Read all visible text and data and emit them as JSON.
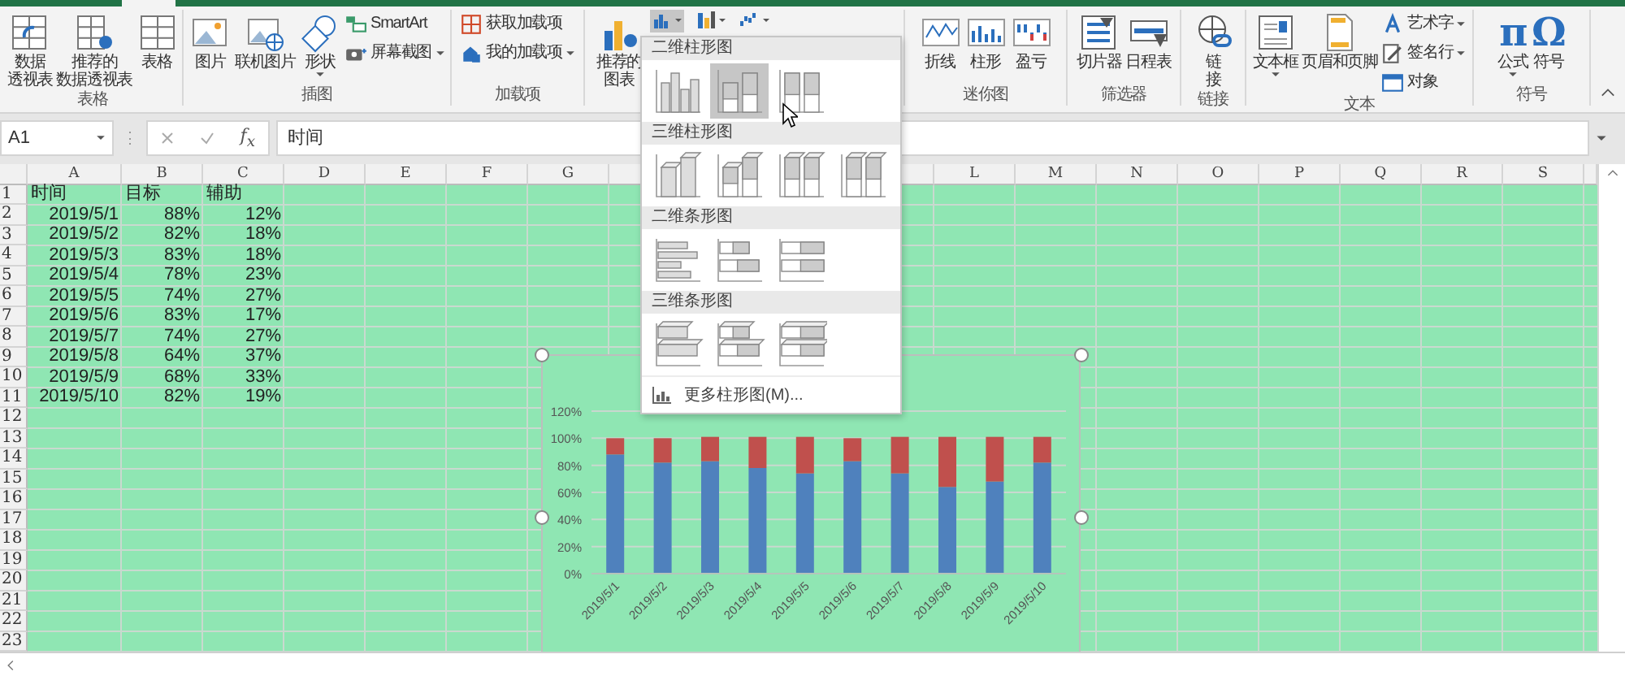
{
  "ribbon": {
    "groups": [
      {
        "label": "表格",
        "items": [
          {
            "kind": "large",
            "lines": [
              "数据",
              "透视表"
            ],
            "dropdown": false
          },
          {
            "kind": "large",
            "lines": [
              "推荐的",
              "数据透视表"
            ],
            "dropdown": false
          },
          {
            "kind": "large",
            "lines": [
              "表格"
            ],
            "dropdown": false
          }
        ]
      },
      {
        "label": "插图",
        "items": [
          {
            "kind": "large",
            "lines": [
              "图片"
            ],
            "dropdown": false
          },
          {
            "kind": "large",
            "lines": [
              "联机图片"
            ],
            "dropdown": false
          },
          {
            "kind": "large",
            "lines": [
              "形状"
            ],
            "dropdown": true
          },
          {
            "kind": "stack",
            "entries": [
              {
                "label": "SmartArt",
                "dropdown": false
              },
              {
                "label": "屏幕截图",
                "dropdown": true
              }
            ]
          }
        ]
      },
      {
        "label": "加载项",
        "items": [
          {
            "kind": "stack",
            "entries": [
              {
                "label": "获取加载项",
                "dropdown": false
              },
              {
                "label": "我的加载项",
                "dropdown": true
              }
            ]
          }
        ]
      },
      {
        "items": [
          {
            "kind": "large",
            "lines": [
              "推荐的",
              "图表"
            ],
            "dropdown": false
          },
          {
            "kind": "gallery",
            "buttons": [
              {
                "dropdown": true,
                "selected": true
              },
              {
                "dropdown": true,
                "selected": false
              },
              {
                "dropdown": true,
                "selected": false
              }
            ]
          }
        ]
      },
      {
        "label": "迷你图",
        "items": [
          {
            "kind": "large",
            "lines": [
              "折线"
            ],
            "dropdown": false
          },
          {
            "kind": "large",
            "lines": [
              "柱形"
            ],
            "dropdown": false
          },
          {
            "kind": "large",
            "lines": [
              "盈亏"
            ],
            "dropdown": false
          }
        ]
      },
      {
        "label": "筛选器",
        "items": [
          {
            "kind": "large",
            "lines": [
              "切片器"
            ],
            "dropdown": false
          },
          {
            "kind": "large",
            "lines": [
              "日程表"
            ],
            "dropdown": false
          }
        ]
      },
      {
        "label": "链接",
        "items": [
          {
            "kind": "large",
            "lines": [
              "链",
              "接"
            ],
            "dropdown": false
          }
        ]
      },
      {
        "label": "文本",
        "items": [
          {
            "kind": "large",
            "lines": [
              "文本框"
            ],
            "dropdown": true
          },
          {
            "kind": "large",
            "lines": [
              "页眉和页脚"
            ],
            "dropdown": false
          },
          {
            "kind": "stack",
            "entries": [
              {
                "label": "艺术字",
                "dropdown": true
              },
              {
                "label": "签名行",
                "dropdown": true
              },
              {
                "label": "对象",
                "dropdown": false
              }
            ]
          }
        ]
      },
      {
        "label": "符号",
        "items": [
          {
            "kind": "large",
            "glyph": "π",
            "lines": [
              "公式"
            ],
            "dropdown": true
          },
          {
            "kind": "large",
            "glyph": "Ω",
            "lines": [
              "符号"
            ],
            "dropdown": false
          }
        ]
      }
    ]
  },
  "formula_bar": {
    "name_box": "A1",
    "function_symbol": "f$_{x}$",
    "content": "时间"
  },
  "sheet": {
    "columns": [
      "A",
      "B",
      "C",
      "D",
      "E",
      "F",
      "G",
      "L",
      "M",
      "N",
      "O",
      "P",
      "Q",
      "R",
      "S"
    ],
    "rows": [
      {
        "number": "1",
        "kind": "header",
        "cells": [
          "时间",
          "目标",
          "辅助"
        ]
      },
      {
        "number": "2",
        "kind": "data",
        "cells": [
          "2019/5/1",
          "88%",
          "12%"
        ]
      },
      {
        "number": "3",
        "kind": "data",
        "cells": [
          "2019/5/2",
          "82%",
          "18%"
        ]
      },
      {
        "number": "4",
        "kind": "data",
        "cells": [
          "2019/5/3",
          "83%",
          "18%"
        ]
      },
      {
        "number": "5",
        "kind": "data",
        "cells": [
          "2019/5/4",
          "78%",
          "23%"
        ]
      },
      {
        "number": "6",
        "kind": "data",
        "cells": [
          "2019/5/5",
          "74%",
          "27%"
        ]
      },
      {
        "number": "7",
        "kind": "data",
        "cells": [
          "2019/5/6",
          "83%",
          "17%"
        ]
      },
      {
        "number": "8",
        "kind": "data",
        "cells": [
          "2019/5/7",
          "74%",
          "27%"
        ]
      },
      {
        "number": "9",
        "kind": "data",
        "cells": [
          "2019/5/8",
          "64%",
          "37%"
        ]
      },
      {
        "number": "10",
        "kind": "data",
        "cells": [
          "2019/5/9",
          "68%",
          "33%"
        ]
      },
      {
        "number": "11",
        "kind": "data",
        "cells": [
          "2019/5/10",
          "82%",
          "19%"
        ]
      },
      {
        "number": "12"
      },
      {
        "number": "13"
      },
      {
        "number": "14"
      },
      {
        "number": "15"
      },
      {
        "number": "16"
      },
      {
        "number": "17"
      },
      {
        "number": "18"
      },
      {
        "number": "19"
      },
      {
        "number": "20"
      },
      {
        "number": "21"
      },
      {
        "number": "22"
      },
      {
        "number": "23"
      }
    ]
  },
  "chart_dropdown": {
    "sections": [
      {
        "title": "二维柱形图",
        "options": [
          {
            "selected": false
          },
          {
            "selected": true
          },
          {
            "selected": false
          }
        ]
      },
      {
        "title": "三维柱形图",
        "options": [
          {
            "selected": false
          },
          {
            "selected": false
          },
          {
            "selected": false
          },
          {
            "selected": false
          }
        ]
      },
      {
        "title": "二维条形图",
        "options": [
          {
            "selected": false
          },
          {
            "selected": false
          },
          {
            "selected": false
          }
        ]
      },
      {
        "title": "三维条形图",
        "options": [
          {
            "selected": false
          },
          {
            "selected": false
          },
          {
            "selected": false
          }
        ]
      }
    ],
    "footer": "更多柱形图(M)..."
  },
  "chart": {
    "chart_data": {
      "type": "bar",
      "stacked": true,
      "orientation": "vertical",
      "categories": [
        "2019/5/1",
        "2019/5/2",
        "2019/5/3",
        "2019/5/4",
        "2019/5/5",
        "2019/5/6",
        "2019/5/7",
        "2019/5/8",
        "2019/5/9",
        "2019/5/10"
      ],
      "series": [
        {
          "color": "#4f81bd",
          "values": [
            0.88,
            0.82,
            0.83,
            0.78,
            0.74,
            0.83,
            0.74,
            0.64,
            0.68,
            0.82
          ]
        },
        {
          "color": "#c0504d",
          "values": [
            0.12,
            0.18,
            0.18,
            0.23,
            0.27,
            0.17,
            0.27,
            0.37,
            0.33,
            0.19
          ]
        }
      ],
      "ylim": [
        0,
        1.2
      ],
      "grid": true,
      "yticks": [
        {
          "value": 0,
          "label": "0%"
        },
        {
          "value": 0.2,
          "label": "20%"
        },
        {
          "value": 0.4,
          "label": "40%"
        },
        {
          "value": 0.6,
          "label": "60%"
        },
        {
          "value": 0.8,
          "label": "80%"
        },
        {
          "value": 1,
          "label": "100%"
        },
        {
          "value": 1.2,
          "label": "120%"
        }
      ]
    }
  }
}
